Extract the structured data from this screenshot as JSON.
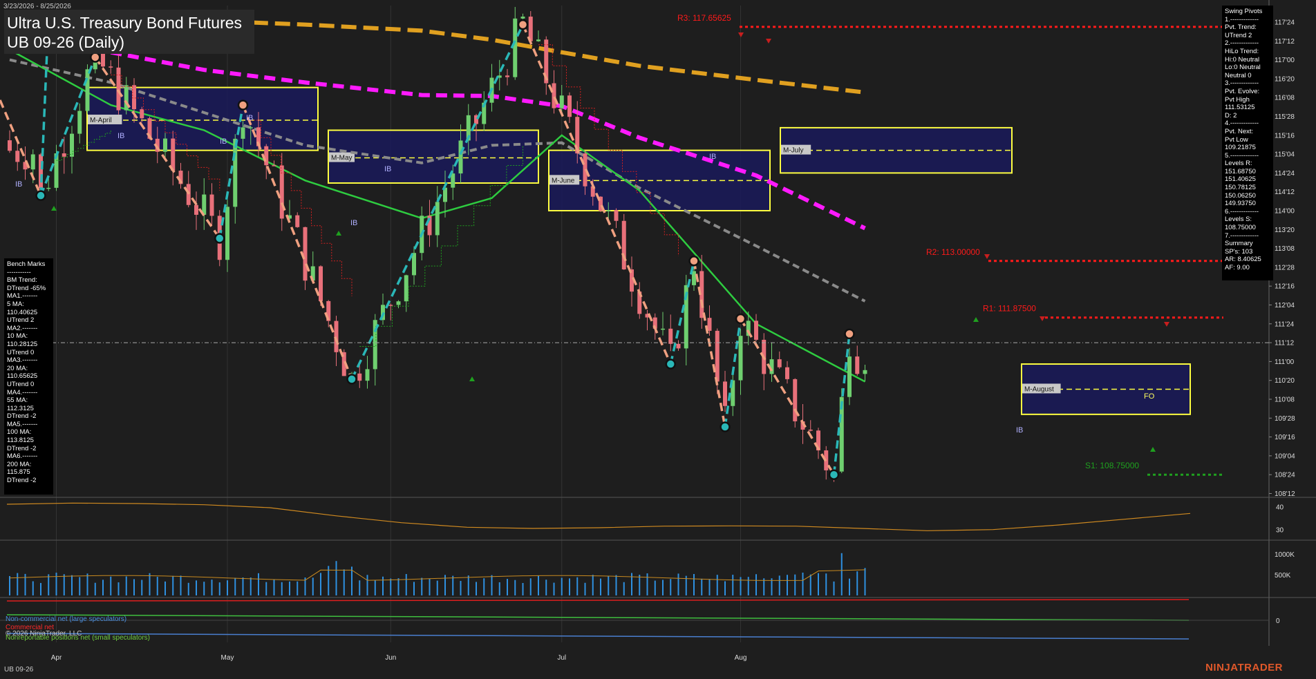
{
  "header": {
    "date_range": "3/23/2026 - 8/25/2026",
    "title": "Ultra U.S. Treasury Bond Futures",
    "subtitle": "UB 09-26 (Daily)",
    "symbol": "UB 09-26",
    "brand": "NINJATRADER",
    "copyright": "© 2026 NinjaTrader, LLC"
  },
  "bench_marks": {
    "lines": [
      "Bench Marks",
      "-----------",
      "BM Trend:",
      "DTrend -65%",
      "MA1.-------",
      "5 MA:",
      "110.40625",
      "UTrend 2",
      "MA2.-------",
      "10 MA:",
      "110.28125",
      "UTrend 0",
      "MA3.-------",
      "20 MA:",
      "110.65625",
      "UTrend 0",
      "MA4.-------",
      "55 MA:",
      "112.3125",
      "DTrend -2",
      "MA5.-------",
      "100 MA:",
      "113.8125",
      "DTrend -2",
      "MA6.-------",
      "200 MA:",
      "115.875",
      "DTrend -2"
    ]
  },
  "swing_pivots": {
    "lines": [
      "Swing Pivots",
      "1.-------------",
      "Pvt. Trend:",
      "UTrend 2",
      "2.-------------",
      "HiLo Trend:",
      "Hi:0 Neutral",
      "Lo:0 Neutral",
      "Neutral 0",
      "3.-------------",
      "Pvt. Evolve:",
      "Pvt High",
      "111.53125",
      "D: 2",
      "4.-------------",
      "Pvt. Next:",
      "Pvt Low",
      "109.21875",
      "5.-------------",
      "Levels R:",
      "151.68750",
      "151.40625",
      "150.78125",
      "150.06250",
      "149.93750",
      "6.-------------",
      "Levels S:",
      "108.75000",
      "7.-------------",
      "Summary",
      "SP's: 103",
      "AR: 8.40625",
      "AF: 9.00"
    ]
  },
  "legend": {
    "noncommercial": "Non-commercial net (large speculators)",
    "commercial": "Commercial net",
    "nonreportable": "Nonreportable positions net (small speculators)"
  },
  "colors": {
    "background": "#1e1e1e",
    "up_candle": "#6fcf6f",
    "down_candle": "#e8707a",
    "ma_gold": "#e0a020",
    "ma_magenta": "#ff1aff",
    "ma_gray": "#8a8a8a",
    "ma_green": "#2ecc40",
    "swing_up": "#2ab7b7",
    "swing_down": "#f0a080",
    "resistance": "#ff1a1a",
    "support": "#1fa01f",
    "monthly_box_fill": "#1a1a5a",
    "monthly_box_border": "#ffff40"
  },
  "chart_data": {
    "type": "candlestick",
    "x_labels": [
      "Apr",
      "May",
      "Jun",
      "Jul",
      "Aug"
    ],
    "y_ticks": [
      "117'24",
      "117'12",
      "117'00",
      "116'20",
      "116'08",
      "115'28",
      "115'16",
      "115'04",
      "114'24",
      "114'12",
      "114'00",
      "113'20",
      "113'08",
      "112'28",
      "112'16",
      "112'04",
      "111'24",
      "111'12",
      "111'00",
      "110'20",
      "110'08",
      "109'28",
      "109'16",
      "109'04",
      "108'24",
      "108'12"
    ],
    "y_range": [
      108.2,
      117.95
    ],
    "y_range_note": "price axis tick labels in 32nds",
    "last_price": 111.375,
    "pivot_levels": [
      {
        "label": "R3: 117.65625",
        "value": 117.65625,
        "color": "#ff1a1a"
      },
      {
        "label": "R2: 113.00000",
        "value": 113.0,
        "color": "#ff1a1a"
      },
      {
        "label": "R1: 111.87500",
        "value": 111.875,
        "color": "#ff1a1a"
      },
      {
        "label": "S1: 108.75000",
        "value": 108.75,
        "color": "#1fa01f"
      }
    ],
    "monthly_boxes": [
      {
        "label": "M-April",
        "low": 115.2,
        "high": 116.45,
        "mid": 115.8
      },
      {
        "label": "M-May",
        "low": 114.55,
        "high": 115.6,
        "mid": 115.05
      },
      {
        "label": "M-June",
        "low": 114.0,
        "high": 115.2,
        "mid": 114.6
      },
      {
        "label": "M-July",
        "low": 114.75,
        "high": 115.65,
        "mid": 115.2
      },
      {
        "label": "M-August",
        "low": 109.95,
        "high": 110.95,
        "mid": 110.45
      }
    ],
    "ib_labels": [
      "IB",
      "IB",
      "IB",
      "IB",
      "IB",
      "IB",
      "IB",
      "IB"
    ],
    "fo_label": "FO",
    "swing_points": [
      {
        "d": "2026-03-30",
        "v": 114.3
      },
      {
        "d": "2026-04-08",
        "v": 117.05
      },
      {
        "d": "2026-04-30",
        "v": 113.45
      },
      {
        "d": "2026-05-05",
        "v": 116.1
      },
      {
        "d": "2026-05-25",
        "v": 110.65
      },
      {
        "d": "2026-06-24",
        "v": 117.7
      },
      {
        "d": "2026-07-21",
        "v": 110.95
      },
      {
        "d": "2026-07-24",
        "v": 113.0
      },
      {
        "d": "2026-07-30",
        "v": 109.7
      },
      {
        "d": "2026-08-03",
        "v": 111.85
      },
      {
        "d": "2026-08-19",
        "v": 108.75
      },
      {
        "d": "2026-08-21",
        "v": 111.55
      }
    ],
    "moving_averages": [
      {
        "name": "200 MA",
        "color": "#e0a020",
        "values": [
          117.9,
          117.85,
          117.78,
          117.7,
          117.58,
          117.4,
          117.15,
          116.88,
          116.6,
          116.35
        ]
      },
      {
        "name": "100 MA",
        "color": "#ff1aff",
        "values": [
          117.6,
          117.15,
          116.8,
          116.55,
          116.3,
          116.28,
          116.08,
          115.45,
          114.7,
          113.65
        ]
      },
      {
        "name": "55 MA",
        "color": "#8a8a8a",
        "values": [
          117.0,
          116.55,
          115.95,
          115.3,
          114.95,
          115.3,
          115.35,
          114.45,
          113.3,
          112.2
        ]
      },
      {
        "name": "20 MA",
        "color": "#2ecc40",
        "values": [
          117.2,
          116.1,
          115.6,
          114.6,
          113.85,
          114.25,
          115.5,
          114.4,
          111.75,
          110.6
        ]
      }
    ],
    "ma_x_dates": [
      "2026-03-24",
      "2026-04-10",
      "2026-04-28",
      "2026-05-15",
      "2026-06-05",
      "2026-06-18",
      "2026-07-01",
      "2026-07-15",
      "2026-08-05",
      "2026-08-25"
    ],
    "indicator1": {
      "ticks": [
        "40",
        "30"
      ],
      "range": [
        26,
        44
      ],
      "values": [
        41,
        41.5,
        41.3,
        40.8,
        39.5,
        36,
        33,
        31,
        30.5,
        30.8,
        31.5,
        31.6,
        31.5,
        30.5,
        29.5,
        30,
        32,
        34.5,
        37
      ]
    },
    "volume": {
      "ticks": [
        "1000K",
        "500K"
      ],
      "range": [
        0,
        1250000
      ]
    },
    "cot": {
      "tick": "0"
    }
  }
}
